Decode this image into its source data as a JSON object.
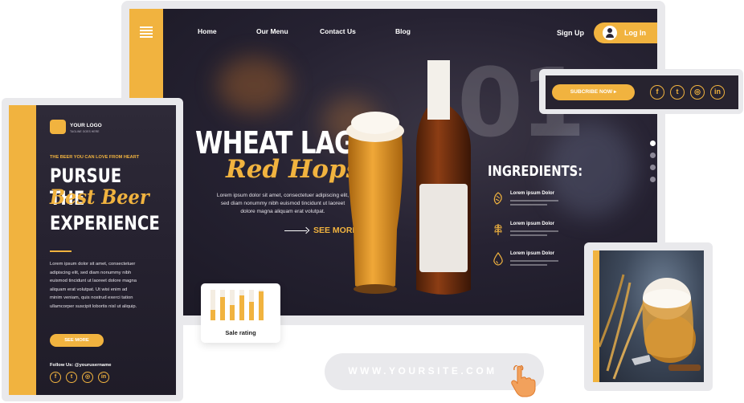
{
  "nav": {
    "links": [
      "Home",
      "Our Menu",
      "Contact Us",
      "Blog"
    ],
    "signup": "Sign Up",
    "login": "Log In"
  },
  "hero": {
    "number": "01",
    "title": "WHEAT LAGER",
    "script": "Red Hops",
    "body": "Lorem ipsum dolor sit amet, consectetuer adipiscing elit, sed diam nonummy nibh euismod tincidunt ut laoreet dolore magna aliquam erat volutpat.",
    "see_more": "SEE MORE"
  },
  "ingredients": {
    "title": "INGREDIENTS:",
    "items": [
      {
        "title": "Lorem ipsum Dolor",
        "icon": "hops-icon"
      },
      {
        "title": "Lorem ipsum Dolor",
        "icon": "wheat-icon"
      },
      {
        "title": "Lorem ipsum Dolor",
        "icon": "water-drop-icon"
      }
    ]
  },
  "slider": {
    "count": 4,
    "active": 0
  },
  "subscribe": {
    "button": "SUBCRIBE NOW",
    "socials": [
      {
        "glyph": "f",
        "icon": "facebook-icon"
      },
      {
        "glyph": "t",
        "icon": "twitter-icon"
      },
      {
        "glyph": "◎",
        "icon": "instagram-icon"
      },
      {
        "glyph": "in",
        "icon": "linkedin-icon"
      }
    ]
  },
  "mobile": {
    "logo": "YOUR LOGO",
    "logo_sub": "TAGLINE GOES HERE",
    "eyebrow": "THE BEER YOU CAN LOVE FROM HEART",
    "title_1": "PURSUE THE",
    "script": "Best Beer",
    "title_2": "EXPERIENCE",
    "body": "Lorem ipsum dolor sit amet, consectetuer adipiscing elit, sed diam nonummy nibh euismod tincidunt ut laoreet dolore magna aliquam erat volutpat. Ut wisi enim ad minim veniam, quis nostrud exerci tation ullamcorper suscipit lobortis nisl ut aliquip.",
    "see_more": "SEE MORE",
    "follow": "Follow Us: @yourusername",
    "socials": [
      {
        "glyph": "f",
        "icon": "facebook-icon"
      },
      {
        "glyph": "t",
        "icon": "twitter-icon"
      },
      {
        "glyph": "◎",
        "icon": "instagram-icon"
      },
      {
        "glyph": "in",
        "icon": "linkedin-icon"
      }
    ]
  },
  "rating": {
    "label": "Sale rating",
    "levels": [
      0.35,
      0.75,
      0.5,
      0.82,
      0.6,
      0.95
    ]
  },
  "url": "WWW.YOURSITE.COM",
  "colors": {
    "accent": "#f1b33f",
    "dark": "#262232",
    "frame": "#e9e9ec"
  }
}
